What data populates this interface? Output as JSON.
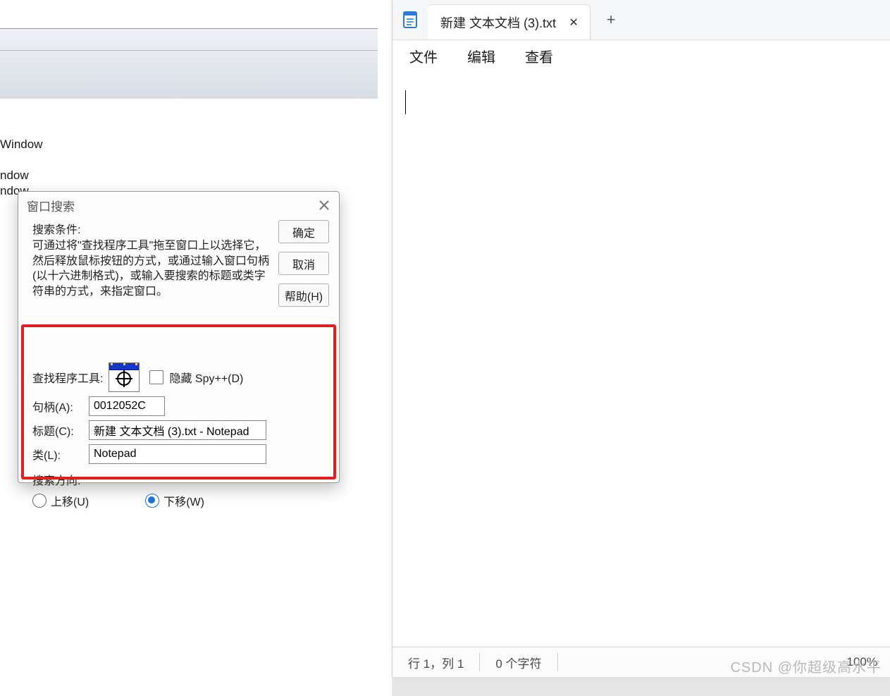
{
  "background": {
    "line1": "Window",
    "line2": "ndow",
    "line3": "ndow"
  },
  "dialog": {
    "title": "窗口搜索",
    "desc_header": "搜索条件:",
    "desc_text": "可通过将\"查找程序工具\"拖至窗口上以选择它，然后释放鼠标按钮的方式，或通过输入窗口句柄(以十六进制格式)，或输入要搜索的标题或类字符串的方式，来指定窗口。",
    "ok": "确定",
    "cancel": "取消",
    "help": "帮助(H)",
    "finder_label": "查找程序工具:",
    "hide_label": "隐藏 Spy++(D)",
    "handle_label": "句柄(A):",
    "handle_value": "0012052C",
    "caption_label": "标题(C):",
    "caption_value": "新建 文本文档 (3).txt - Notepad",
    "class_label": "类(L):",
    "class_value": "Notepad",
    "direction_label": "搜索方向:",
    "up_label": "上移(U)",
    "down_label": "下移(W)"
  },
  "notepad": {
    "tab_title": "新建 文本文档 (3).txt",
    "close_glyph": "✕",
    "add_glyph": "+",
    "menu_file": "文件",
    "menu_edit": "编辑",
    "menu_view": "查看",
    "status_pos": "行 1，列 1",
    "status_chars": "0 个字符",
    "status_zoom": "100%"
  },
  "watermark": "CSDN @你超级高水平"
}
